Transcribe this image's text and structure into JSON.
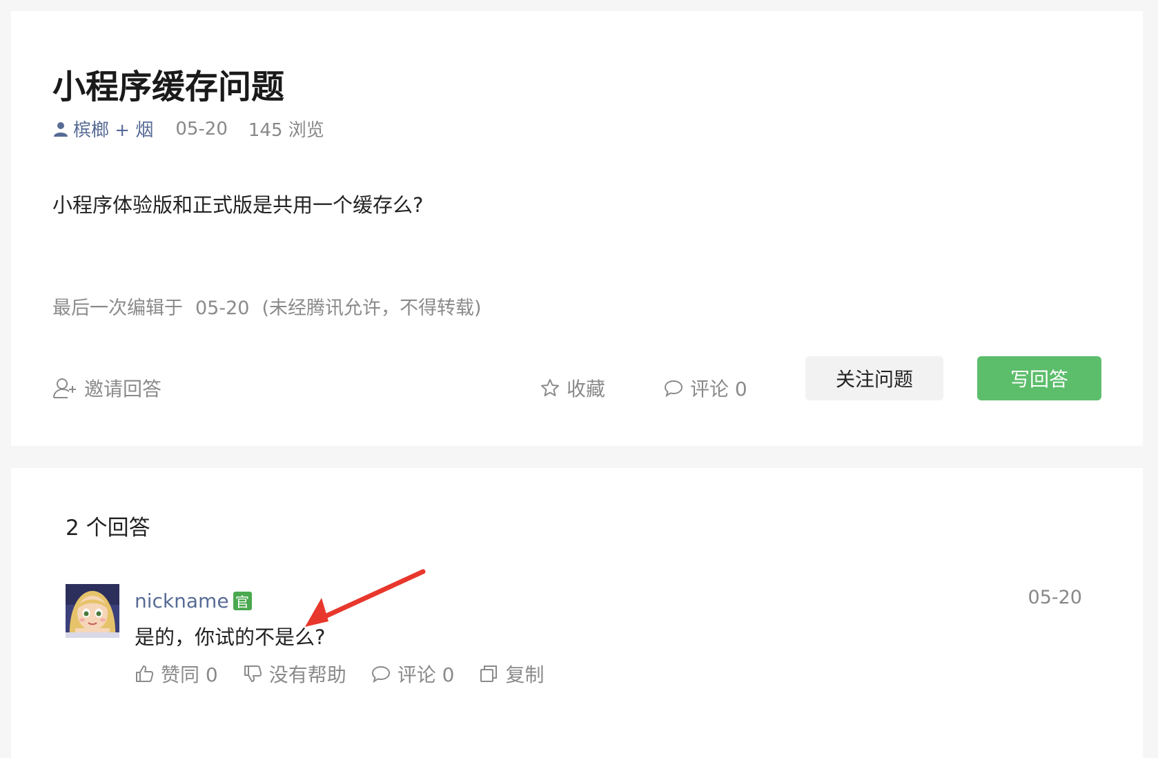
{
  "question": {
    "title": "小程序缓存问题",
    "author": "槟榔 + 烟",
    "date": "05-20",
    "views": "145 浏览",
    "body": "小程序体验版和正式版是共用一个缓存么?",
    "edit_note_label": "最后一次编辑于",
    "edit_note_date": "05-20",
    "edit_note_rights": "(未经腾讯允许，不得转载)",
    "actions": {
      "invite": "邀请回答",
      "collect": "收藏",
      "comment": "评论 0"
    },
    "buttons": {
      "follow": "关注问题",
      "write_answer": "写回答"
    }
  },
  "answers": {
    "count_label": "2 个回答",
    "items": [
      {
        "nickname": "nickname",
        "badge": "官",
        "date": "05-20",
        "content": "是的，你试的不是么?",
        "actions": {
          "agree": "赞同 0",
          "unhelpful": "没有帮助",
          "comment": "评论 0",
          "copy": "复制"
        }
      }
    ]
  },
  "colors": {
    "link": "#576b95",
    "primary_button": "#5cbd6b",
    "badge": "#4aa84f",
    "annotation_arrow": "#e8372c"
  },
  "icons": {
    "author": "user-icon",
    "invite": "invite-user-icon",
    "collect": "star-icon",
    "comment": "comment-bubble-icon",
    "agree": "thumbs-up-icon",
    "unhelpful": "thumbs-down-icon",
    "copy": "copy-icon"
  }
}
